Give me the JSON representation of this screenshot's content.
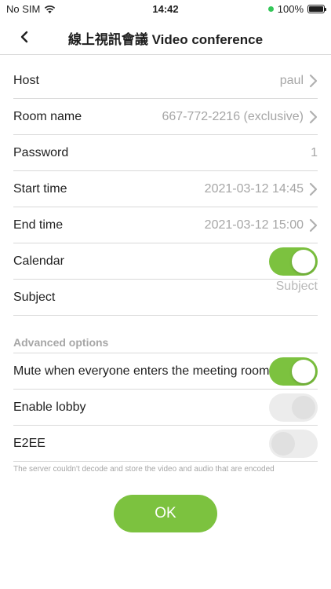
{
  "status_bar": {
    "carrier": "No SIM",
    "time": "14:42",
    "battery": "100%"
  },
  "nav": {
    "title": "線上視訊會議 Video conference"
  },
  "rows": {
    "host": {
      "label": "Host",
      "value": "paul"
    },
    "room": {
      "label": "Room name",
      "value": "667-772-2216 (exclusive)"
    },
    "password": {
      "label": "Password",
      "value": "1"
    },
    "start": {
      "label": "Start time",
      "value": "2021-03-12 14:45"
    },
    "end": {
      "label": "End time",
      "value": "2021-03-12 15:00"
    },
    "calendar": {
      "label": "Calendar",
      "state": "on"
    },
    "subject": {
      "label": "Subject",
      "placeholder": "Subject"
    }
  },
  "advanced": {
    "header": "Advanced options",
    "mute": {
      "label": "Mute when everyone enters the meeting room",
      "state": "on"
    },
    "lobby": {
      "label": "Enable lobby",
      "state": "off"
    },
    "e2ee": {
      "label": "E2EE",
      "state": "off"
    },
    "footnote": "The server couldn't decode and store the video and audio that are encoded"
  },
  "ok_label": "OK",
  "colors": {
    "accent": "#7cc23f",
    "muted_text": "#a6a6a6",
    "divider": "#d9d9d9"
  }
}
